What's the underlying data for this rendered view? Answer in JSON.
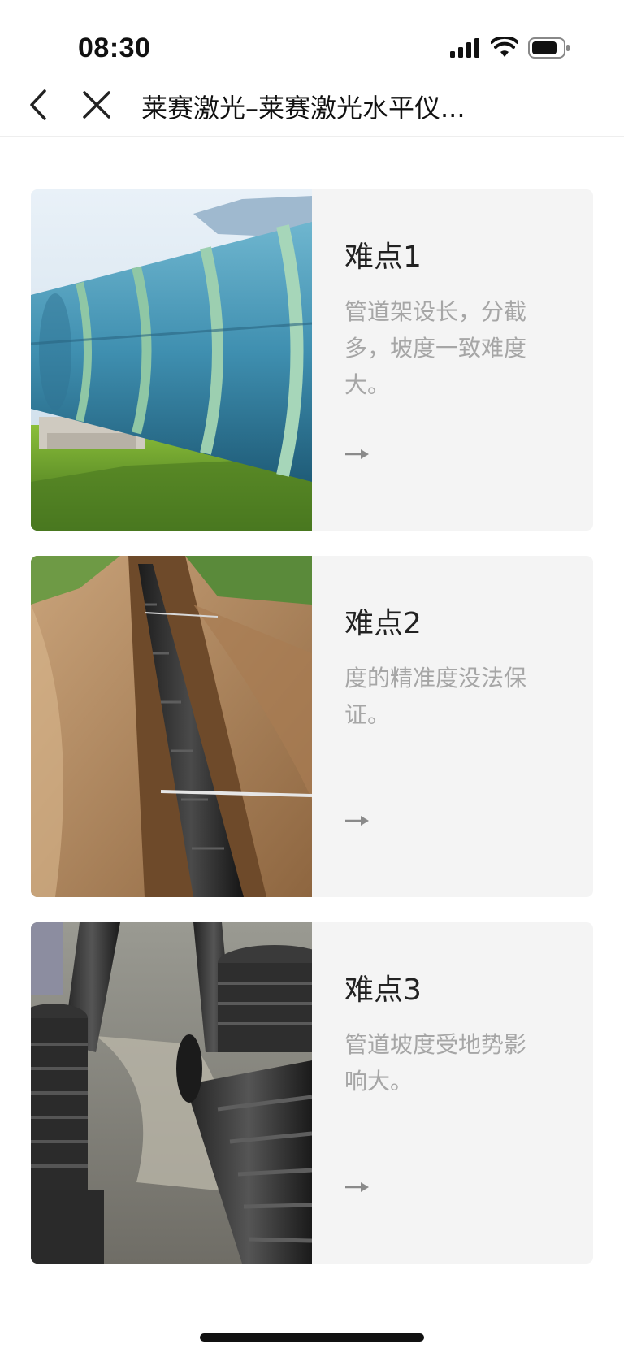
{
  "status_bar": {
    "time": "08:30"
  },
  "nav": {
    "title": "莱赛激光–莱赛激光水平仪..."
  },
  "cards": [
    {
      "title": "难点1",
      "description": "管道架设长，分截多，坡度一致难度大。"
    },
    {
      "title": "难点2",
      "description": "度的精准度没法保证。"
    },
    {
      "title": "难点3",
      "description": "管道坡度受地势影响大。"
    }
  ],
  "colors": {
    "card_bg": "#f4f4f4",
    "desc_text": "#a6a6a6",
    "title_text": "#222222"
  }
}
